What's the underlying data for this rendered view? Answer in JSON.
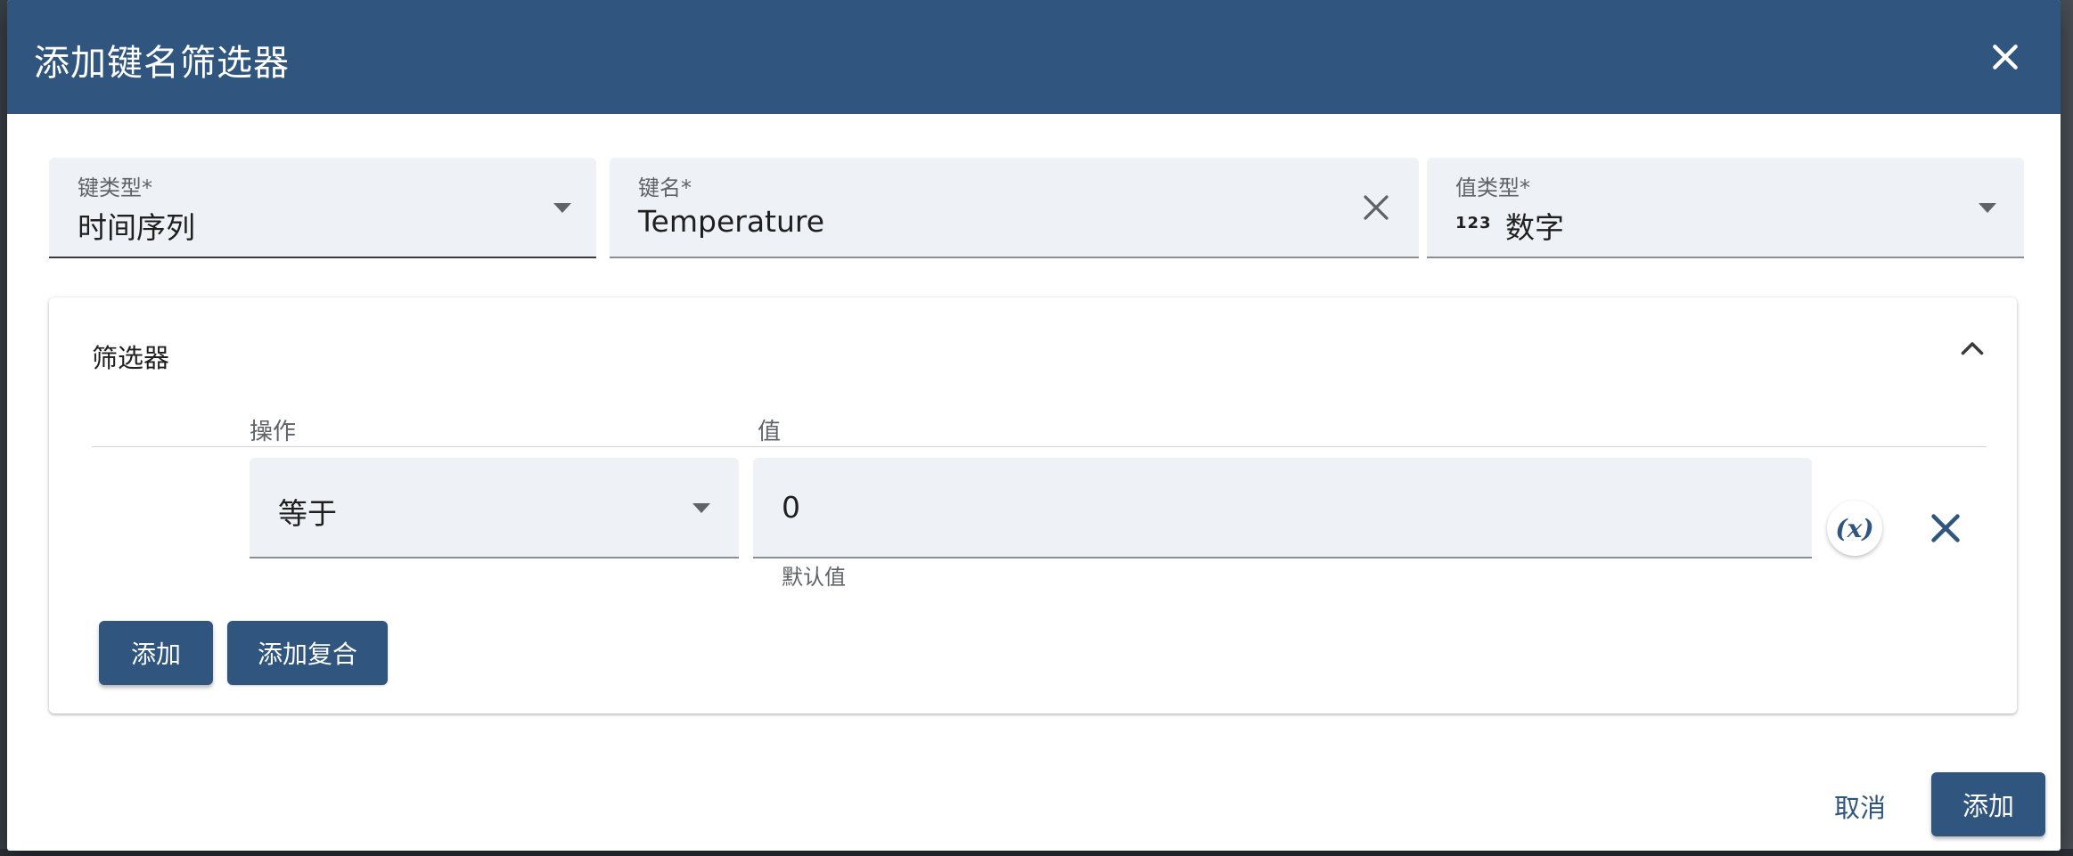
{
  "dialog": {
    "title": "添加键名筛选器"
  },
  "fields": {
    "key_type": {
      "label": "键类型*",
      "value": "时间序列"
    },
    "key_name": {
      "label": "键名*",
      "value": "Temperature"
    },
    "value_type": {
      "label": "值类型*",
      "icon_text": "123",
      "value": "数字"
    }
  },
  "filters": {
    "title": "筛选器",
    "columns": {
      "operation": "操作",
      "value": "值"
    },
    "row": {
      "operation": "等于",
      "value": "0",
      "hint": "默认值",
      "variable_button": "(x)"
    },
    "buttons": {
      "add": "添加",
      "add_complex": "添加复合"
    }
  },
  "footer": {
    "cancel": "取消",
    "submit": "添加"
  },
  "colors": {
    "primary": "#305680",
    "field_bg": "#eef2f6"
  }
}
